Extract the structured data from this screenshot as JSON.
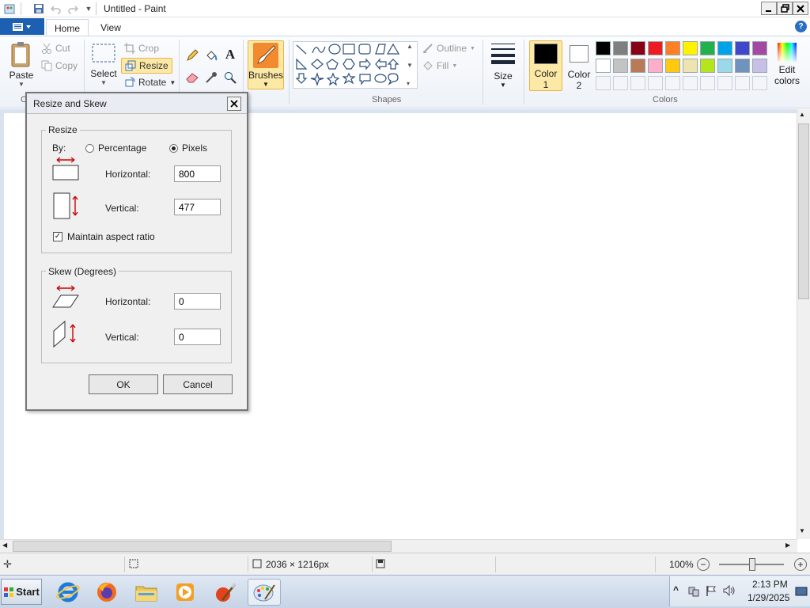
{
  "window": {
    "title": "Untitled - Paint"
  },
  "tabs": {
    "file": "",
    "home": "Home",
    "view": "View"
  },
  "ribbon": {
    "clipboard": {
      "paste": "Paste",
      "cut": "Cut",
      "copy": "Copy",
      "label": "C"
    },
    "image": {
      "select": "Select",
      "crop": "Crop",
      "resize": "Resize",
      "rotate": "Rotate"
    },
    "brushes": {
      "label": "Brushes"
    },
    "shapes": {
      "label": "Shapes",
      "outline": "Outline",
      "fill": "Fill"
    },
    "size": {
      "label": "Size"
    },
    "color1": {
      "label": "Color",
      "num": "1"
    },
    "color2": {
      "label": "Color",
      "num": "2"
    },
    "colors": {
      "label": "Colors",
      "edit_line1": "Edit",
      "edit_line2": "colors",
      "row1": [
        "#000000",
        "#7f7f7f",
        "#880015",
        "#ed1c24",
        "#ff7f27",
        "#fff200",
        "#22b14c",
        "#00a2e8",
        "#3f48cc",
        "#a349a4"
      ],
      "row2": [
        "#ffffff",
        "#c3c3c3",
        "#b97a57",
        "#ffaec9",
        "#ffc90e",
        "#efe4b0",
        "#b5e61d",
        "#99d9ea",
        "#7092be",
        "#c8bfe7"
      ]
    }
  },
  "dialog": {
    "title": "Resize and Skew",
    "resize": {
      "legend": "Resize",
      "by_label": "By:",
      "percentage": "Percentage",
      "pixels": "Pixels",
      "selected": "pixels",
      "horizontal_label": "Horizontal:",
      "horizontal_value": "800",
      "vertical_label": "Vertical:",
      "vertical_value": "477",
      "maintain": "Maintain aspect ratio",
      "maintain_checked": true
    },
    "skew": {
      "legend": "Skew (Degrees)",
      "horizontal_label": "Horizontal:",
      "horizontal_value": "0",
      "vertical_label": "Vertical:",
      "vertical_value": "0"
    },
    "ok": "OK",
    "cancel": "Cancel"
  },
  "status": {
    "dimensions": "2036 × 1216px",
    "zoom": "100%"
  },
  "taskbar": {
    "start": "Start",
    "time": "2:13 PM",
    "date": "1/29/2025"
  }
}
